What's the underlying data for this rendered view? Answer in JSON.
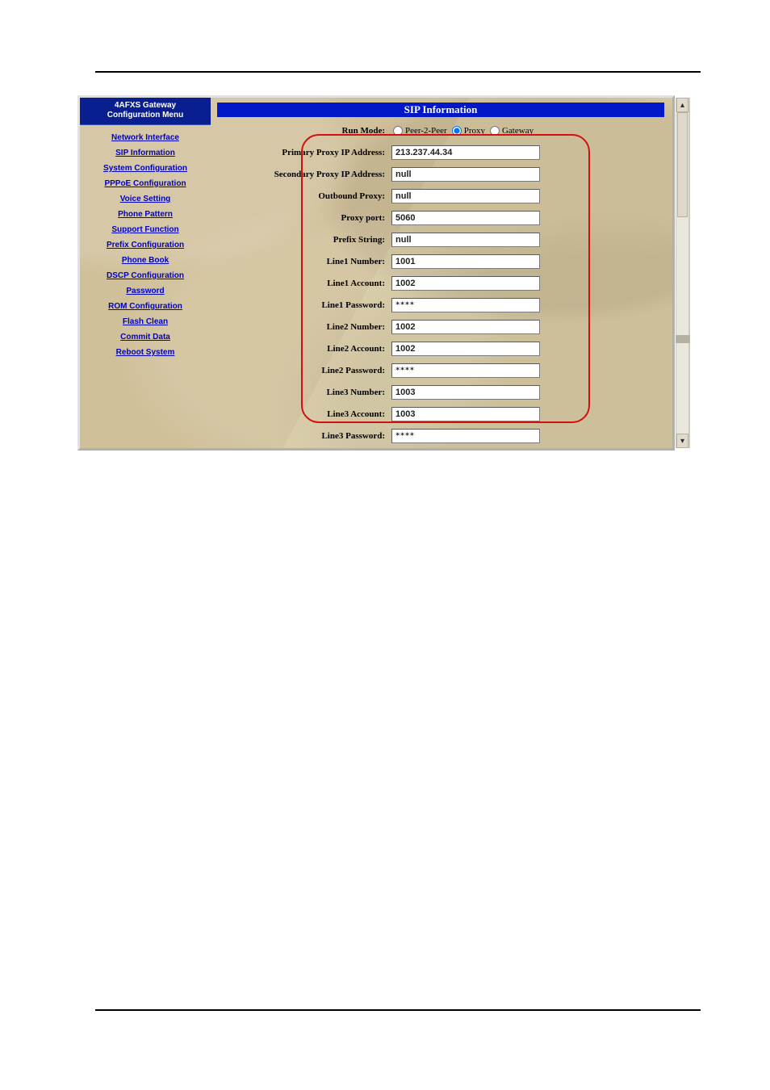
{
  "sidebar": {
    "title_line1": "4AFXS Gateway",
    "title_line2": "Configuration Menu",
    "links": [
      "Network Interface",
      "SIP Information",
      "System Configuration",
      "PPPoE Configuration",
      "Voice Setting",
      "Phone Pattern",
      "Support Function",
      "Prefix Configuration",
      "Phone Book",
      "DSCP Configuration",
      "Password",
      "ROM Configuration",
      "Flash Clean",
      "Commit Data",
      "Reboot System"
    ]
  },
  "panel": {
    "title": "SIP Information",
    "runmode": {
      "label": "Run Mode:",
      "options": [
        "Peer-2-Peer",
        "Proxy",
        "Gateway"
      ],
      "selected": "Proxy"
    },
    "fields": [
      {
        "label": "Primary Proxy IP Address:",
        "value": "213.237.44.34"
      },
      {
        "label": "Secondary Proxy IP Address:",
        "value": "null"
      },
      {
        "label": "Outbound Proxy:",
        "value": "null"
      },
      {
        "label": "Proxy port:",
        "value": "5060"
      },
      {
        "label": "Prefix String:",
        "value": "null"
      },
      {
        "label": "Line1 Number:",
        "value": "1001"
      },
      {
        "label": "Line1 Account:",
        "value": "1002"
      },
      {
        "label": "Line1 Password:",
        "value": "****",
        "pw": true
      },
      {
        "label": "Line2 Number:",
        "value": "1002"
      },
      {
        "label": "Line2 Account:",
        "value": "1002"
      },
      {
        "label": "Line2 Password:",
        "value": "****",
        "pw": true
      },
      {
        "label": "Line3 Number:",
        "value": "1003"
      },
      {
        "label": "Line3 Account:",
        "value": "1003"
      },
      {
        "label": "Line3 Password:",
        "value": "****",
        "pw": true
      }
    ]
  },
  "scroll": {
    "arrow_up": "▴",
    "arrow_dn": "▾"
  }
}
